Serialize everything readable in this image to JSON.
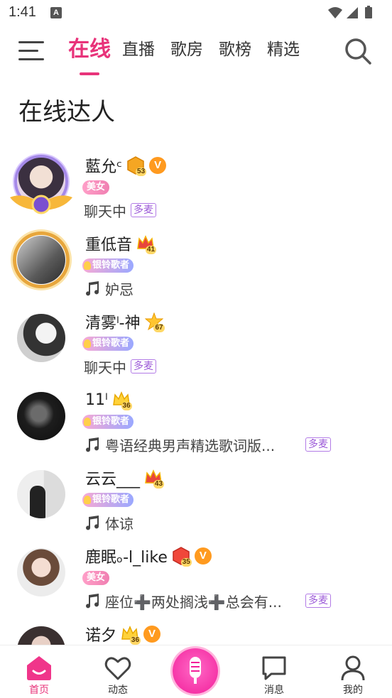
{
  "status_bar": {
    "time": "1:41",
    "notification_glyph": "A"
  },
  "nav": {
    "tabs": [
      {
        "label": "在线",
        "active": true
      },
      {
        "label": "直播",
        "active": false
      },
      {
        "label": "歌房",
        "active": false
      },
      {
        "label": "歌榜",
        "active": false
      },
      {
        "label": "精选",
        "active": false
      }
    ]
  },
  "section": {
    "title": "在线达人"
  },
  "users": [
    {
      "name": "藍允ᶜ",
      "level": "53",
      "verified": "V",
      "tag": "美女",
      "status": "聊天中",
      "status_type": "chat",
      "duo": "多麦"
    },
    {
      "name": "重低音",
      "level": "41",
      "verified": "",
      "tag": "银铃歌者",
      "status": "妒忌",
      "status_type": "music",
      "duo": ""
    },
    {
      "name": "清雾ˡ-神",
      "level": "67",
      "verified": "",
      "tag": "银铃歌者",
      "status": "聊天中",
      "status_type": "chat",
      "duo": "多麦"
    },
    {
      "name": "11ˡ",
      "level": "36",
      "verified": "",
      "tag": "银铃歌者",
      "status": "粤语经典男声精选歌词版...",
      "status_type": "music",
      "duo": "多麦"
    },
    {
      "name": "云云___",
      "level": "43",
      "verified": "",
      "tag": "银铃歌者",
      "status": "体谅",
      "status_type": "music",
      "duo": ""
    },
    {
      "name": "鹿眠ₒ-l_like",
      "level": "35",
      "verified": "V",
      "tag": "美女",
      "status": "座位➕两处搁浅➕总会有...",
      "status_type": "music",
      "duo": "多麦"
    },
    {
      "name": "诺夕",
      "level": "36",
      "verified": "V",
      "tag": "",
      "status": "",
      "status_type": "none",
      "duo": ""
    }
  ],
  "bottom_nav": [
    {
      "label": "首页",
      "icon": "home-icon",
      "active": true
    },
    {
      "label": "动态",
      "icon": "heart-icon",
      "active": false
    },
    {
      "label": "",
      "icon": "mic-icon",
      "active": false
    },
    {
      "label": "消息",
      "icon": "message-icon",
      "active": false
    },
    {
      "label": "我的",
      "icon": "profile-icon",
      "active": false
    }
  ],
  "colors": {
    "accent": "#e8337a",
    "verified": "#ff9a1f",
    "duo": "#9c5ad8"
  }
}
